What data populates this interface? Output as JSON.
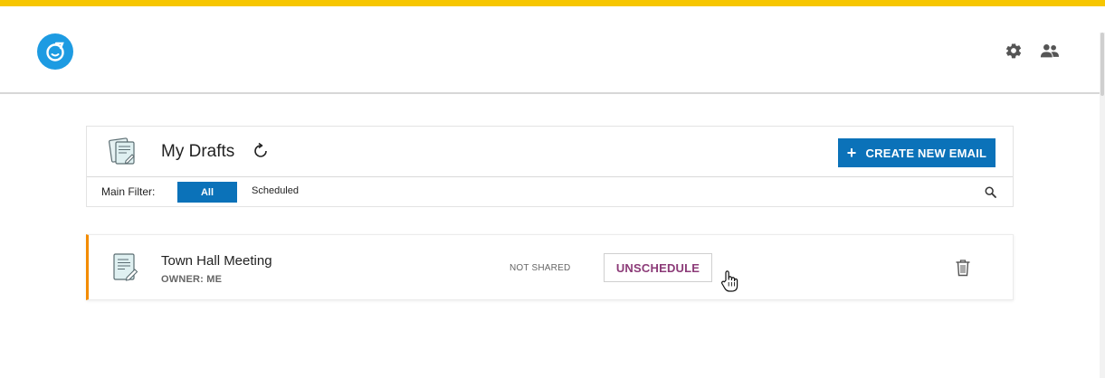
{
  "colors": {
    "accent_bar": "#f7c600",
    "primary": "#0b72b9",
    "logo": "#1d9be2",
    "card_accent": "#f38b00",
    "unschedule_text": "#8c3b78"
  },
  "header": {
    "logo_icon": "app-logo-icon",
    "icons": [
      "gear-icon",
      "people-icon"
    ]
  },
  "panel": {
    "title": "My Drafts",
    "create_button_label": "CREATE NEW EMAIL",
    "create_button_icon": "+",
    "filter": {
      "label": "Main Filter:",
      "options": [
        "All",
        "Scheduled"
      ],
      "selected": "All"
    }
  },
  "drafts": [
    {
      "title": "Town Hall Meeting",
      "owner": "OWNER: ME",
      "status": "NOT SHARED",
      "action_label": "UNSCHEDULE"
    }
  ]
}
